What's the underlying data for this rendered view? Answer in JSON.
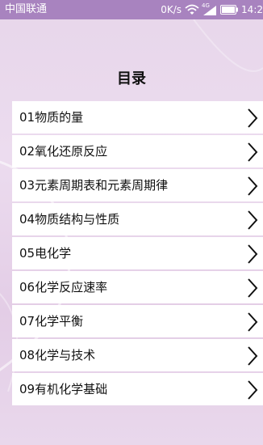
{
  "status_bar": {
    "carrier": "中国联通",
    "net_speed": "0K/s",
    "network_type": "4G",
    "time": "14:2"
  },
  "page": {
    "title": "目录"
  },
  "menu": {
    "items": [
      {
        "label": "01物质的量",
        "icon": "chevron-right-icon"
      },
      {
        "label": "02氧化还原反应",
        "icon": "chevron-right-icon"
      },
      {
        "label": "03元素周期表和元素周期律",
        "icon": "chevron-right-icon"
      },
      {
        "label": "04物质结构与性质",
        "icon": "chevron-right-icon"
      },
      {
        "label": "05电化学",
        "icon": "chevron-right-icon"
      },
      {
        "label": "06化学反应速率",
        "icon": "chevron-right-icon"
      },
      {
        "label": "07化学平衡",
        "icon": "chevron-right-icon"
      },
      {
        "label": "08化学与技术",
        "icon": "chevron-right-icon"
      },
      {
        "label": "09有机化学基础",
        "icon": "chevron-right-icon"
      }
    ]
  },
  "colors": {
    "status_bar": "#a883bf",
    "background": "#e7d6ea",
    "item_background": "#ffffff",
    "text": "#111111"
  }
}
